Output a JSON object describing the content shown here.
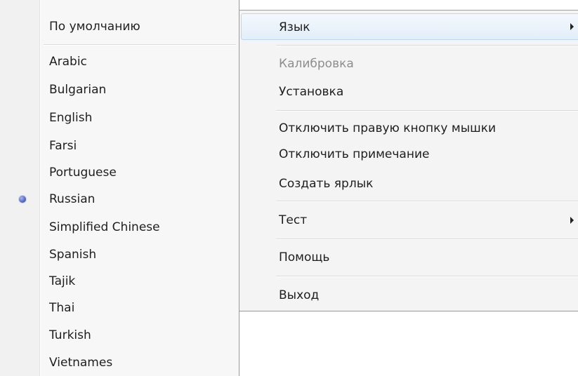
{
  "language_menu": {
    "default_label": "По умолчанию",
    "selected": "Russian",
    "items": [
      "Arabic",
      "Bulgarian",
      "English",
      "Farsi",
      "Portuguese",
      "Russian",
      "Simplified Chinese",
      "Spanish",
      "Tajik",
      "Thai",
      "Turkish",
      "Vietnames"
    ]
  },
  "main_menu": {
    "language": "Язык",
    "calibration": "Калибровка",
    "setup": "Установка",
    "disable_right_click": "Отключить правую кнопку мышки",
    "disable_note": "Отключить примечание",
    "create_shortcut": "Создать ярлык",
    "test": "Тест",
    "help": "Помощь",
    "exit": "Выход"
  },
  "icons": {
    "radio": "radio-selected-icon",
    "submenu_arrow": "submenu-arrow-icon"
  },
  "colors": {
    "highlight": "#e3eef9",
    "disabled_text": "#8d8d8d",
    "radio": "#5a6cc2"
  }
}
